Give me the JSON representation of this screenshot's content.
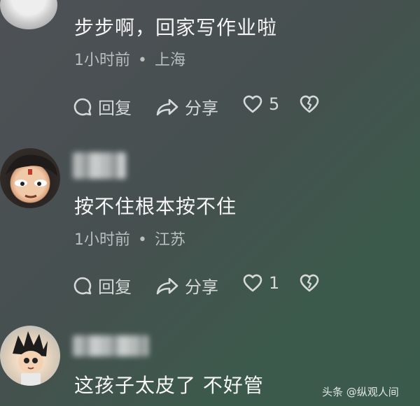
{
  "comments": [
    {
      "text": "步步啊，回家写作业啦",
      "time": "1小时前",
      "sep": "•",
      "location": "上海",
      "reply_label": "回复",
      "share_label": "分享",
      "like_count": "5"
    },
    {
      "text": "按不住根本按不住",
      "time": "1小时前",
      "sep": "•",
      "location": "江苏",
      "reply_label": "回复",
      "share_label": "分享",
      "like_count": "1"
    },
    {
      "text": "这孩子太皮了 不好管"
    }
  ],
  "watermark": {
    "text": "头条 @纵观人间"
  },
  "colors": {
    "text": "#f5f5f5",
    "meta": "#b9bfbf",
    "icon": "#d6d9d9"
  }
}
